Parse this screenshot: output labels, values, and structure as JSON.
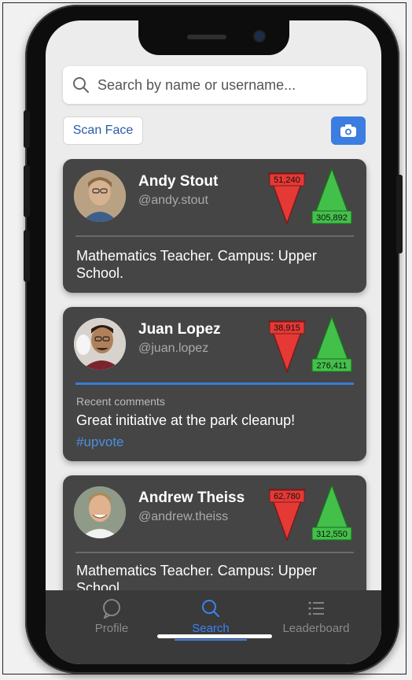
{
  "search": {
    "placeholder": "Search by name or username..."
  },
  "scan_face_label": "Scan Face",
  "users": [
    {
      "name": "Andy Stout",
      "handle": "@andy.stout",
      "downvotes": "51,240",
      "upvotes": "305,892",
      "bio": "Mathematics Teacher. Campus: Upper School."
    },
    {
      "name": "Juan Lopez",
      "handle": "@juan.lopez",
      "downvotes": "38,915",
      "upvotes": "276,411",
      "comments_label": "Recent comments",
      "comment": "Great initiative at the park cleanup!",
      "hashtag": "#upvote"
    },
    {
      "name": "Andrew Theiss",
      "handle": "@andrew.theiss",
      "downvotes": "62,780",
      "upvotes": "312,550",
      "bio": "Mathematics Teacher. Campus: Upper School."
    }
  ],
  "tabs": [
    {
      "label": "Profile",
      "icon": "chat-bubble-icon",
      "active": false
    },
    {
      "label": "Search",
      "icon": "search-icon",
      "active": true
    },
    {
      "label": "Leaderboard",
      "icon": "list-icon",
      "active": false
    }
  ],
  "colors": {
    "accent": "#3b82f6",
    "downvote": "#e53935",
    "upvote": "#43c04a",
    "card": "#454545"
  }
}
